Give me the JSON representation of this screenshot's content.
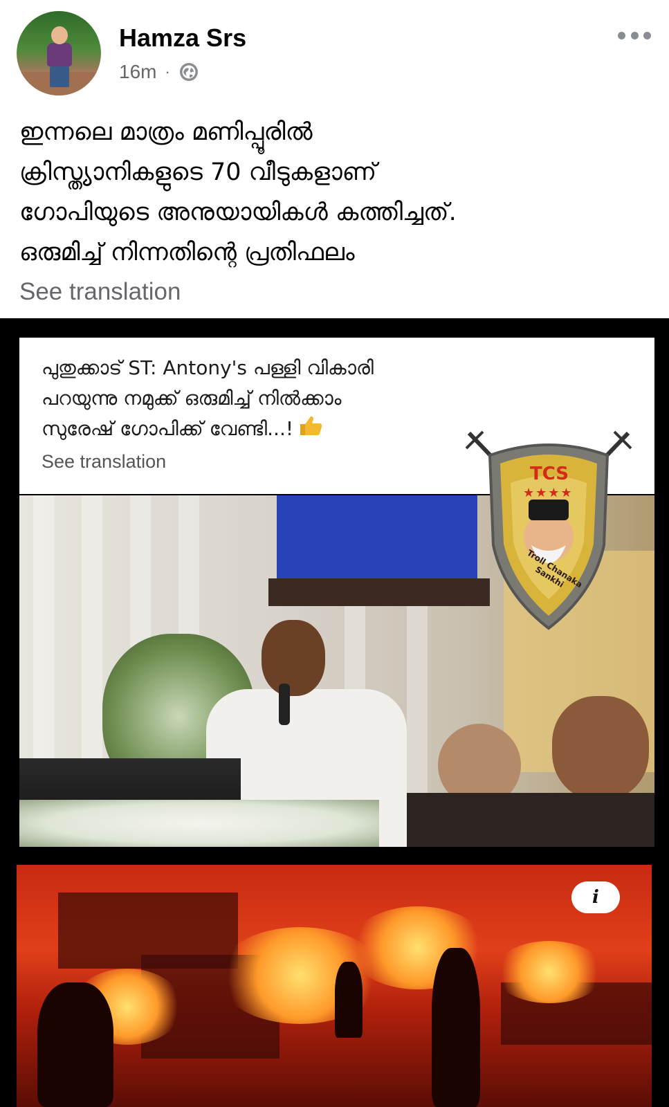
{
  "post": {
    "author": "Hamza Srs",
    "time": "16m",
    "separator": "·",
    "privacy_icon": "globe-icon",
    "more_icon": "more-options-icon",
    "text": "ഇന്നലെ മാത്രം മണിപ്പൂരിൽ\nക്രിസ്ത്യാനികളുടെ 70 വീടുകളാണ്\nഗോപിയുടെ അനുയായികൾ കത്തിച്ചത്.\nഒരുമിച്ച് നിന്നതിന്റെ പ്രതിഫലം",
    "see_translation": "See translation"
  },
  "shared_image": {
    "caption": "പുതുക്കാട് ST: Antony's പള്ളി വികാരി\nപറയുന്നു നമുക്ക് ഒരുമിച്ച് നിൽക്കാം\nസുരേഷ് ഗോപിക്ക് വേണ്ടി...!",
    "caption_icon": "thumbs-up-icon",
    "see_translation": "See translation",
    "watermark": {
      "badge_text": "TCS",
      "stars": "★★★★",
      "arc_text": "Troll Chanaka Sankhi"
    },
    "info_label": "i"
  },
  "colors": {
    "meta_gray": "#65676b",
    "watermark_red": "#d42a1a",
    "watermark_gold": "#d9b43a"
  }
}
